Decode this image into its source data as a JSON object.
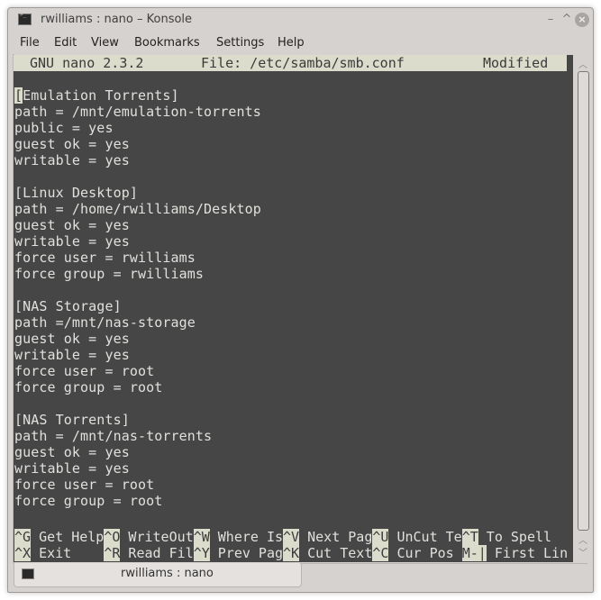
{
  "window": {
    "title": "rwilliams : nano – Konsole",
    "buttons": {
      "minimize": "–",
      "maximize": "^",
      "close": "×"
    }
  },
  "menubar": [
    "File",
    "Edit",
    "View",
    "Bookmarks",
    "Settings",
    "Help"
  ],
  "nano": {
    "version": "GNU nano 2.3.2",
    "file": "File: /etc/samba/smb.conf",
    "status": "Modified",
    "cursor_char": "[",
    "lines": [
      "",
      "Emulation Torrents]",
      "path = /mnt/emulation-torrents",
      "public = yes",
      "guest ok = yes",
      "writable = yes",
      "",
      "[Linux Desktop]",
      "path = /home/rwilliams/Desktop",
      "guest ok = yes",
      "writable = yes",
      "force user = rwilliams",
      "force group = rwilliams",
      "",
      "[NAS Storage]",
      "path =/mnt/nas-storage",
      "guest ok = yes",
      "writable = yes",
      "force user = root",
      "force group = root",
      "",
      "[NAS Torrents]",
      "path = /mnt/nas-torrents",
      "guest ok = yes",
      "writable = yes",
      "force user = root",
      "force group = root"
    ],
    "shortcuts_row1": [
      {
        "key": "^G",
        "label": " Get Help"
      },
      {
        "key": "^O",
        "label": " WriteOut"
      },
      {
        "key": "^W",
        "label": " Where Is"
      },
      {
        "key": "^V",
        "label": " Next Pag"
      },
      {
        "key": "^U",
        "label": " UnCut Te"
      },
      {
        "key": "^T",
        "label": " To Spell"
      }
    ],
    "shortcuts_row2": [
      {
        "key": "^X",
        "label": " Exit    "
      },
      {
        "key": "^R",
        "label": " Read Fil"
      },
      {
        "key": "^Y",
        "label": " Prev Pag"
      },
      {
        "key": "^K",
        "label": " Cut Text"
      },
      {
        "key": "^C",
        "label": " Cur Pos "
      },
      {
        "key": "M-|",
        "label": " First Lin"
      }
    ]
  },
  "tabs": [
    {
      "label": "rwilliams : nano"
    }
  ],
  "icons": {
    "app": "terminal-icon",
    "tab": "terminal-icon"
  }
}
